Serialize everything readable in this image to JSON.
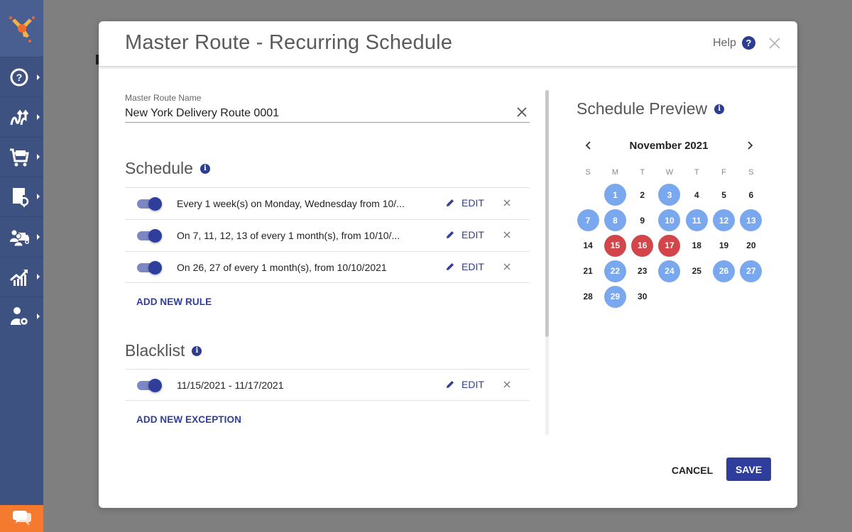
{
  "sidebar": {
    "items": [
      {
        "name": "help",
        "icon": "question-circle-icon"
      },
      {
        "name": "routes",
        "icon": "routes-icon"
      },
      {
        "name": "orders",
        "icon": "cart-icon"
      },
      {
        "name": "address-book",
        "icon": "address-book-icon"
      },
      {
        "name": "team",
        "icon": "team-vehicle-icon"
      },
      {
        "name": "analytics",
        "icon": "chart-growth-icon"
      },
      {
        "name": "settings",
        "icon": "user-settings-icon"
      }
    ],
    "chat_icon": "chat-bubbles-icon",
    "colors": {
      "bg": "#3e5282",
      "chat": "#f47a2f"
    }
  },
  "modal": {
    "title": "Master Route - Recurring Schedule",
    "help_label": "Help",
    "help_icon_glyph": "?",
    "route_name": {
      "label": "Master Route Name",
      "value": "New York Delivery Route 0001"
    },
    "schedule": {
      "title": "Schedule",
      "info_glyph": "i",
      "rules": [
        {
          "enabled": true,
          "text": "Every 1 week(s) on Monday, Wednesday from 10/...",
          "edit_label": "EDIT"
        },
        {
          "enabled": true,
          "text": "On 7, 11, 12, 13 of every 1 month(s), from 10/10/...",
          "edit_label": "EDIT"
        },
        {
          "enabled": true,
          "text": "On 26, 27 of every 1 month(s), from 10/10/2021",
          "edit_label": "EDIT"
        }
      ],
      "add_label": "ADD NEW RULE"
    },
    "blacklist": {
      "title": "Blacklist",
      "info_glyph": "i",
      "rules": [
        {
          "enabled": true,
          "text": "11/15/2021 - 11/17/2021",
          "edit_label": "EDIT"
        }
      ],
      "add_label": "ADD NEW EXCEPTION"
    },
    "preview": {
      "title": "Schedule Preview",
      "info_glyph": "i",
      "month_label": "November 2021",
      "weekdays": [
        "S",
        "M",
        "T",
        "W",
        "T",
        "F",
        "S"
      ],
      "first_weekday_offset": 1,
      "days_in_month": 30,
      "scheduled_days": [
        1,
        3,
        7,
        8,
        10,
        11,
        12,
        13,
        22,
        24,
        26,
        27,
        29
      ],
      "blacklisted_days": [
        15,
        16,
        17
      ],
      "colors": {
        "scheduled": "#79a8ef",
        "blacklisted": "#d2454b"
      }
    },
    "cancel_label": "CANCEL",
    "save_label": "SAVE",
    "accent_color": "#2f3e9c"
  }
}
